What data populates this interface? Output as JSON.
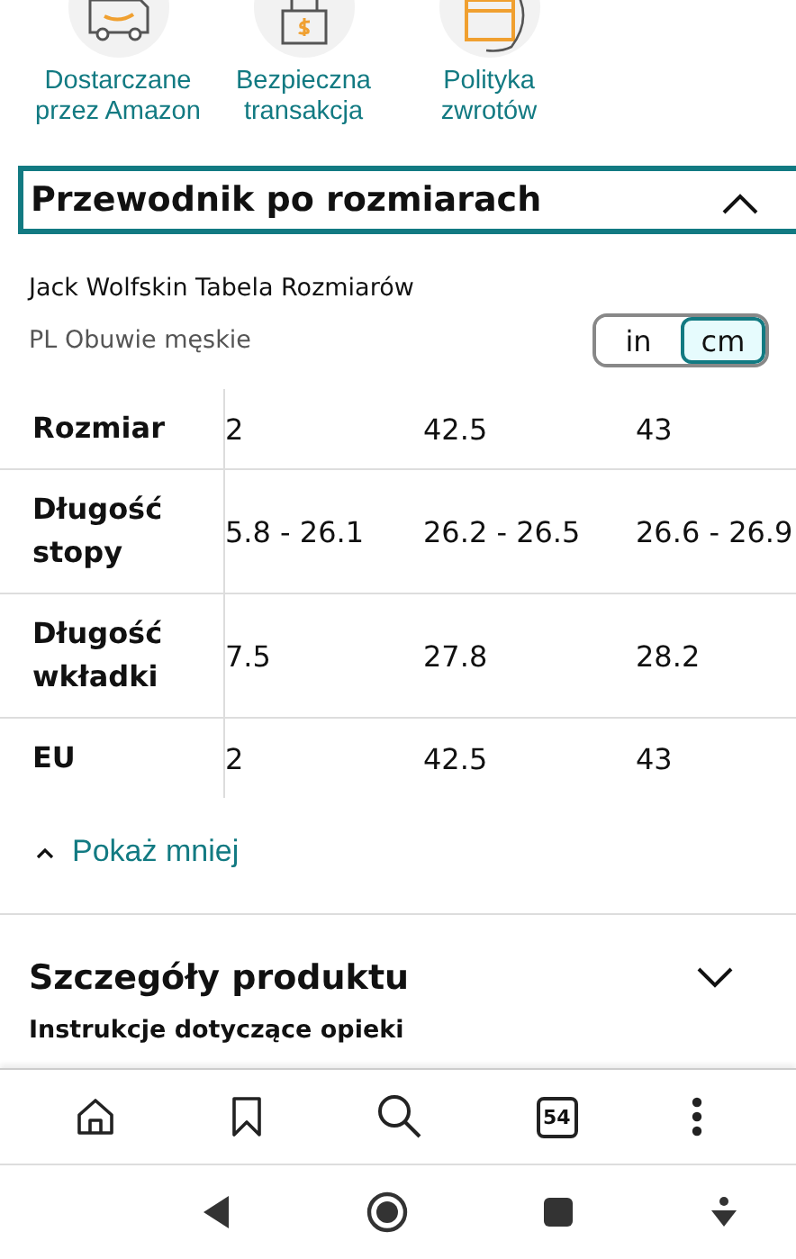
{
  "features": [
    {
      "kind": "truck",
      "label": "Dostarczane przez Amazon"
    },
    {
      "kind": "lock",
      "label": "Bezpieczna transakcja"
    },
    {
      "kind": "box",
      "label": "Polityka zwrotów"
    }
  ],
  "size_guide": {
    "title": "Przewodnik po rozmiarach",
    "expanded": true,
    "brand_title": "Jack Wolfskin Tabela Rozmiarów",
    "category": "PL Obuwie męskie",
    "units": [
      {
        "label": "in",
        "selected": false
      },
      {
        "label": "cm",
        "selected": true
      }
    ],
    "rows": [
      {
        "header": "Rozmiar",
        "cells": [
          "2",
          "42.5",
          "43"
        ]
      },
      {
        "header": "Długość stopy",
        "cells": [
          "5.8 - 26.1",
          "26.2 - 26.5",
          "26.6 - 26.9"
        ]
      },
      {
        "header": "Długość wkładki",
        "cells": [
          "7.5",
          "27.8",
          "28.2"
        ]
      },
      {
        "header": "EU",
        "cells": [
          "2",
          "42.5",
          "43"
        ]
      }
    ],
    "toggle_label": "Pokaż mniej"
  },
  "details": {
    "title": "Szczegóły produktu",
    "expanded": false,
    "subtitle": "Instrukcje dotyczące opieki"
  },
  "bottom_nav": [
    {
      "kind": "home"
    },
    {
      "kind": "bookmark"
    },
    {
      "kind": "search"
    },
    {
      "kind": "tabs",
      "label": "54"
    },
    {
      "kind": "more"
    }
  ],
  "system_nav": [
    {
      "kind": "back"
    },
    {
      "kind": "home"
    },
    {
      "kind": "recents"
    },
    {
      "kind": "assistant"
    }
  ]
}
